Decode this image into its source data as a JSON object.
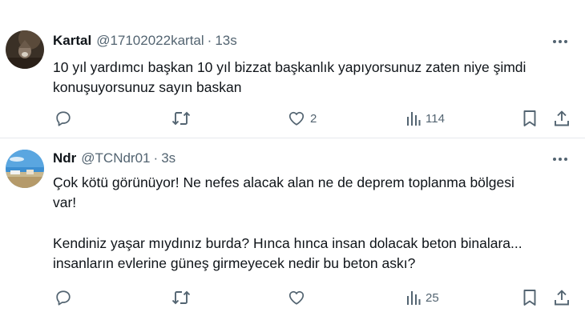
{
  "tweets": [
    {
      "author_name": "Kartal",
      "handle": "@17102022kartal",
      "separator": "·",
      "time": "13s",
      "text_lines": [
        "10 yıl yardımcı başkan 10 yıl bizzat başkanlık yapıyorsunuz zaten niye şimdi",
        "konuşuyorsunuz sayın baskan"
      ],
      "likes": "2",
      "views": "114"
    },
    {
      "author_name": "Ndr",
      "handle": "@TCNdr01",
      "separator": "·",
      "time": "3s",
      "text_lines_a": [
        "Çok kötü görünüyor! Ne nefes alacak alan ne de deprem toplanma bölgesi",
        "var!"
      ],
      "text_lines_b": [
        "Kendiniz yaşar mıydınız burda? Hınca hınca insan dolacak beton binalara...",
        "insanların evlerine güneş girmeyecek nedir bu beton askı?"
      ],
      "views": "25"
    }
  ],
  "icons": {
    "more": "more-dots-icon",
    "reply": "reply-icon",
    "retweet": "retweet-icon",
    "like": "heart-icon",
    "views": "views-bar-chart-icon",
    "bookmark": "bookmark-icon",
    "share": "share-icon"
  },
  "colors": {
    "text": "#0f1419",
    "secondary": "#536471",
    "divider": "#e6e9ec"
  }
}
